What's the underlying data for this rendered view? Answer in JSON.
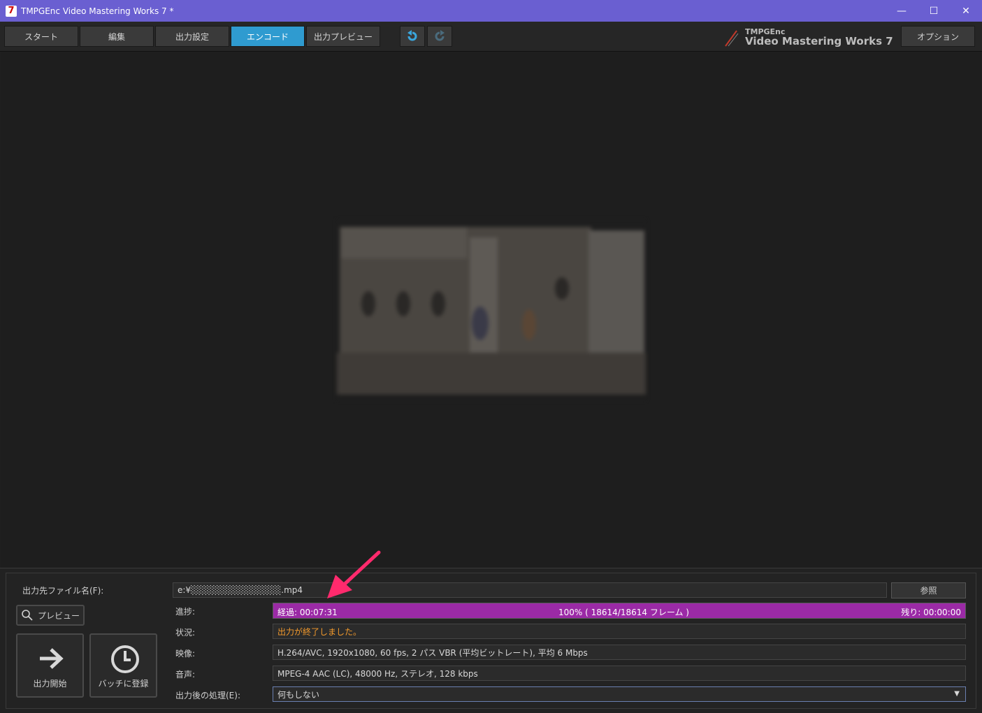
{
  "window": {
    "title": "TMPGEnc Video Mastering Works 7 *",
    "app_icon_glyph": "7",
    "controls": {
      "minimize": "—",
      "maximize": "☐",
      "close": "✕"
    }
  },
  "toolbar": {
    "tabs": [
      {
        "label": "スタート",
        "active": false
      },
      {
        "label": "編集",
        "active": false
      },
      {
        "label": "出力設定",
        "active": false
      },
      {
        "label": "エンコード",
        "active": true
      },
      {
        "label": "出力プレビュー",
        "active": false
      }
    ],
    "undo_icon": "undo-icon",
    "redo_icon": "redo-icon",
    "brand_small": "TMPGEnc",
    "brand_big": "Video Mastering Works 7",
    "options_label": "オプション"
  },
  "encode": {
    "output_file_label": "出力先ファイル名(F):",
    "output_file_value": "e:¥░░░░░░░░░░░░░░.mp4",
    "browse_label": "参照",
    "preview_label": "プレビュー",
    "start_label": "出力開始",
    "batch_label": "バッチに登録",
    "progress_label": "進捗:",
    "progress": {
      "elapsed": "経過: 00:07:31",
      "center": "100% ( 18614/18614 フレーム )",
      "remaining": "残り: 00:00:00",
      "fraction": 1.0
    },
    "status_label": "状況:",
    "status_value": "出力が終了しました。",
    "video_label": "映像:",
    "video_value": "H.264/AVC, 1920x1080, 60 fps, 2 パス VBR (平均ビットレート), 平均 6 Mbps",
    "audio_label": "音声:",
    "audio_value": "MPEG-4 AAC (LC), 48000 Hz, ステレオ, 128 kbps",
    "after_label": "出力後の処理(E):",
    "after_value": "何もしない",
    "dropdown_glyph": "▼"
  },
  "colors": {
    "titlebar": "#6a5fd1",
    "active_tab": "#2f9bd0",
    "progress": "#9b2aa6",
    "status": "#f39a2c",
    "annotation_arrow": "#ff2a6d"
  }
}
